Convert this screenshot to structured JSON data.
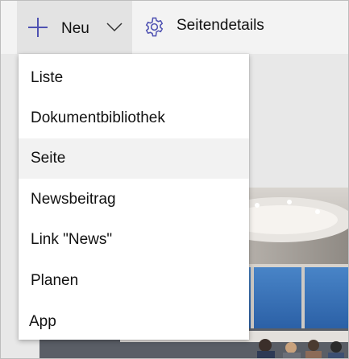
{
  "toolbar": {
    "new_label": "Neu",
    "details_label": "Seitendetails"
  },
  "menu": {
    "items": [
      {
        "label": "Liste"
      },
      {
        "label": "Dokumentbibliothek"
      },
      {
        "label": "Seite"
      },
      {
        "label": "Newsbeitrag"
      },
      {
        "label": "Link \"News\""
      },
      {
        "label": "Planen"
      },
      {
        "label": "App"
      }
    ]
  },
  "icons": {
    "plus": "plus-icon",
    "chevron": "chevron-down-icon",
    "gear": "gear-icon"
  },
  "colors": {
    "accent": "#4f52b2",
    "toolbar_bg": "#f3f3f3",
    "menu_bg": "#ffffff",
    "hover_bg": "#f2f2f2"
  }
}
